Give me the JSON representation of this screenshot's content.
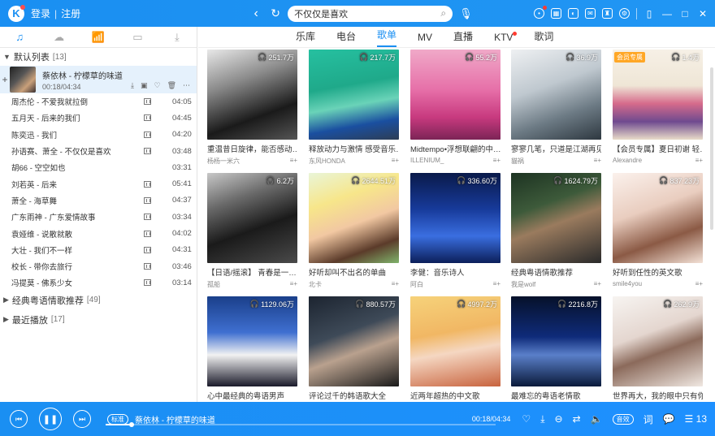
{
  "app": {
    "login": "登录",
    "register": "注册",
    "sep": "|"
  },
  "search": {
    "value": "不仅仅是喜欢"
  },
  "left_tabs": [
    "music-note-icon",
    "cloud-icon",
    "radio-icon",
    "device-icon",
    "download-icon"
  ],
  "default_list": {
    "title": "默认列表",
    "count": "[13]",
    "current": {
      "title": "蔡依林 - 柠檬草的味道",
      "time": "00:18/04:34"
    },
    "songs": [
      {
        "name": "周杰伦 - 不爱我就拉倒",
        "mv": true,
        "dur": "04:05"
      },
      {
        "name": "五月天 - 后来的我们",
        "mv": true,
        "dur": "04:45"
      },
      {
        "name": "陈奕迅 - 我们",
        "mv": true,
        "dur": "04:20"
      },
      {
        "name": "孙语赛、萧全 - 不仅仅是喜欢",
        "mv": true,
        "dur": "03:48"
      },
      {
        "name": "胡66 - 空空如也",
        "mv": false,
        "dur": "03:31"
      },
      {
        "name": "刘若英 - 后来",
        "mv": true,
        "dur": "05:41"
      },
      {
        "name": "萧全 - 海草舞",
        "mv": true,
        "dur": "04:37"
      },
      {
        "name": "广东雨神 - 广东爱情故事",
        "mv": true,
        "dur": "03:34"
      },
      {
        "name": "袁娅维 - 说散就散",
        "mv": true,
        "dur": "04:02"
      },
      {
        "name": "大壮 - 我们不一样",
        "mv": true,
        "dur": "04:31"
      },
      {
        "name": "校长 - 带你去旅行",
        "mv": true,
        "dur": "03:46"
      },
      {
        "name": "冯提莫 - 佛系少女",
        "mv": true,
        "dur": "03:14"
      }
    ]
  },
  "groups": [
    {
      "title": "经典粤语情歌推荐",
      "count": "[49]"
    },
    {
      "title": "最近播放",
      "count": "[17]"
    }
  ],
  "tabs": [
    {
      "label": "乐库",
      "active": false,
      "dot": false
    },
    {
      "label": "电台",
      "active": false,
      "dot": false
    },
    {
      "label": "歌单",
      "active": true,
      "dot": false
    },
    {
      "label": "MV",
      "active": false,
      "dot": false
    },
    {
      "label": "直播",
      "active": false,
      "dot": false
    },
    {
      "label": "KTV",
      "active": false,
      "dot": true
    },
    {
      "label": "歌词",
      "active": false,
      "dot": false
    }
  ],
  "playlists": [
    {
      "title": "重温昔日旋律，能否感动…",
      "author": "杨杨一米六",
      "plays": "251.7万",
      "vip": "",
      "bg": "linear-gradient(160deg,#e8e8e8 0%,#8a8a8a 35%,#1a1a1a 70%,#555 100%)"
    },
    {
      "title": "释放动力与激情 感受音乐…",
      "author": "东风HONDA",
      "plays": "217.7万",
      "vip": "",
      "bg": "linear-gradient(170deg,#26c0a0 0%,#1fa98a 40%,#6ad3b8 60%,#1a4fa0 80%,#2d3e55 100%)"
    },
    {
      "title": "Midtempo•浮想联翩的中…",
      "author": "ILLENIUM_",
      "plays": "55.2万",
      "vip": "",
      "bg": "linear-gradient(180deg,#f0a9c8 0%,#e66fa8 45%,#c83a7f 75%,#7c2456 100%)"
    },
    {
      "title": "寥寥几笔，只道是江湖再见",
      "author": "貓祸",
      "plays": "36.9万",
      "vip": "",
      "bg": "linear-gradient(160deg,#eef0f2 0%,#bfc8cf 40%,#6c7a84 70%,#2e3840 100%)"
    },
    {
      "title": "【会员专属】夏日初谢 轻…",
      "author": "Alexandre",
      "plays": "1.4万",
      "vip": "会员专属",
      "bg": "linear-gradient(180deg,#f6f0e6 0%,#efe6d6 40%,#d66b8b 60%,#6f4a8f 80%,#e9dcc9 100%)"
    },
    {
      "title": "【日语/摇滚】 青春是一…",
      "author": "孤船",
      "plays": "6.2万",
      "vip": "",
      "bg": "linear-gradient(160deg,#c8c8c8 0%,#6a6a6a 30%,#1a1a1a 60%,#4a4a4a 100%)"
    },
    {
      "title": "好听却叫不出名的单曲",
      "author": "北卡",
      "plays": "2644.51万",
      "vip": "",
      "bg": "linear-gradient(160deg,#e9f5d8 0%,#f7e68a 30%,#f2c8a2 55%,#5b3b2a 80%,#7fb36b 100%)"
    },
    {
      "title": "李健：音乐诗人",
      "author": "阿白",
      "plays": "336.60万",
      "vip": "",
      "bg": "linear-gradient(180deg,#0a1a4a 0%,#173a9a 40%,#3a6ee0 70%,#0c1f5a 100%)"
    },
    {
      "title": "经典粤语情歌推荐",
      "author": "我是wolf",
      "plays": "1624.79万",
      "vip": "",
      "bg": "linear-gradient(160deg,#1d3322 0%,#3d5a3a 35%,#9a7b5e 55%,#2a2a2a 100%)"
    },
    {
      "title": "好听到任性的英文歌",
      "author": "smile4you",
      "plays": "837.23万",
      "vip": "",
      "bg": "linear-gradient(160deg,#fbf1ec 0%,#e9cdbf 40%,#8b5a45 70%,#f3e1d6 100%)"
    },
    {
      "title": "心中最经典的粤语男声",
      "author": "",
      "plays": "1129.06万",
      "vip": "",
      "bg": "linear-gradient(180deg,#1a3f8a 0%,#3f6fd0 40%,#f2f2f2 65%,#1a1a2a 100%)"
    },
    {
      "title": "评论过千的韩语歌大全",
      "author": "",
      "plays": "880.57万",
      "vip": "",
      "bg": "linear-gradient(160deg,#1c2430 0%,#3e4a58 40%,#b9a18e 60%,#1a1a1a 100%)"
    },
    {
      "title": "近两年超热的中文歌",
      "author": "",
      "plays": "4997.2万",
      "vip": "",
      "bg": "linear-gradient(170deg,#f6d27a 0%,#f1b764 40%,#f5d7c2 60%,#c8633e 100%)"
    },
    {
      "title": "最难忘的粤语老情歌",
      "author": "",
      "plays": "2216.8万",
      "vip": "",
      "bg": "linear-gradient(180deg,#06112a 0%,#0f2b7a 45%,#5a7fc9 65%,#0a1a3a 100%)"
    },
    {
      "title": "世界再大，我的眼中只有你",
      "author": "",
      "plays": "262.9万",
      "vip": "",
      "bg": "linear-gradient(160deg,#f7f4f1 0%,#e4d6cf 40%,#8b6a5b 60%,#f0e8e2 100%)"
    }
  ],
  "player": {
    "quality": "标准",
    "title": "蔡依林 - 柠檬草的味道",
    "time": "00:18/04:34",
    "progress": 0.066,
    "fx": "音效",
    "lyric": "词",
    "queue_count": "13"
  },
  "colors": {
    "accent": "#1a8ff2",
    "red_dot": "#ff3b30",
    "vip": "#ffa726"
  }
}
